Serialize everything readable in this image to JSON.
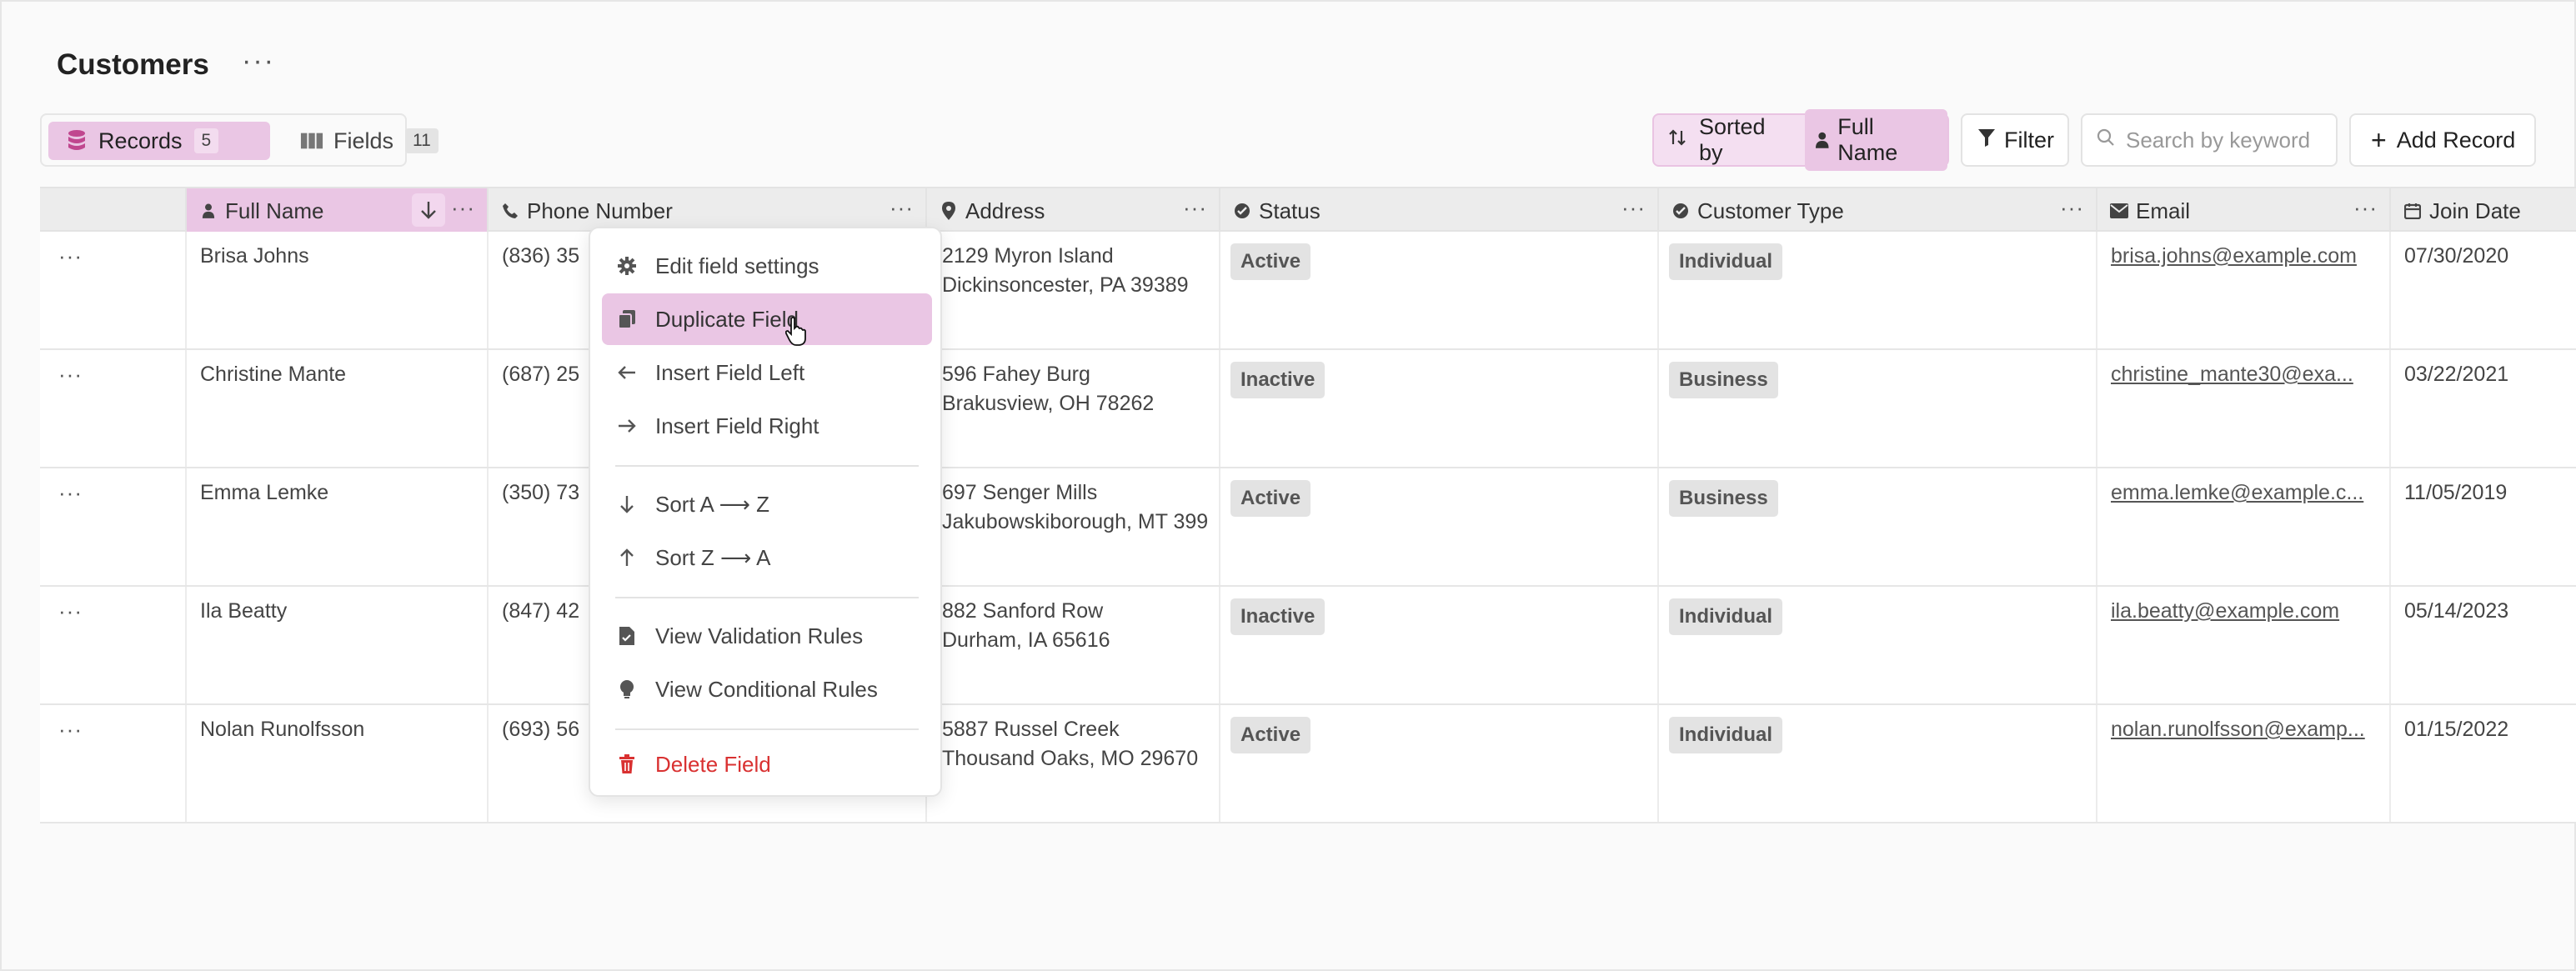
{
  "page": {
    "title": "Customers",
    "title_more": "···"
  },
  "toolbar": {
    "records_label": "Records",
    "records_count": "5",
    "fields_label": "Fields",
    "fields_count": "11",
    "sorted_label": "Sorted by",
    "sorted_field": "Full Name",
    "filter_label": "Filter",
    "search_placeholder": "Search by keyword",
    "add_label": "Add Record"
  },
  "columns": [
    {
      "label": "Full Name",
      "icon": "person-icon"
    },
    {
      "label": "Phone Number",
      "icon": "phone-icon"
    },
    {
      "label": "Address",
      "icon": "pin-icon"
    },
    {
      "label": "Status",
      "icon": "check-circle-icon"
    },
    {
      "label": "Customer Type",
      "icon": "check-circle-icon"
    },
    {
      "label": "Email",
      "icon": "mail-icon"
    },
    {
      "label": "Join Date",
      "icon": "calendar-icon"
    }
  ],
  "row_menu": "···",
  "header_more": "···",
  "rows": [
    {
      "name": "Brisa Johns",
      "phone": "(836) 35",
      "addr1": "2129 Myron Island",
      "addr2": "Dickinsoncester, PA 39389",
      "status": "Active",
      "type": "Individual",
      "email": "brisa.johns@example.com",
      "date": "07/30/2020"
    },
    {
      "name": "Christine Mante",
      "phone": "(687) 25",
      "addr1": "596 Fahey Burg",
      "addr2": "Brakusview, OH 78262",
      "status": "Inactive",
      "type": "Business",
      "email": "christine_mante30@exa...",
      "date": "03/22/2021"
    },
    {
      "name": "Emma Lemke",
      "phone": "(350) 73",
      "addr1": "697 Senger Mills",
      "addr2": "Jakubowskiborough, MT 399",
      "status": "Active",
      "type": "Business",
      "email": "emma.lemke@example.c...",
      "date": "11/05/2019"
    },
    {
      "name": "Ila Beatty",
      "phone": "(847) 42",
      "addr1": "882 Sanford Row",
      "addr2": "Durham, IA 65616",
      "status": "Inactive",
      "type": "Individual",
      "email": "ila.beatty@example.com",
      "date": "05/14/2023"
    },
    {
      "name": "Nolan Runolfsson",
      "phone": "(693) 56",
      "addr1": "5887 Russel Creek",
      "addr2": "Thousand Oaks, MO 29670",
      "status": "Active",
      "type": "Individual",
      "email": "nolan.runolfsson@examp...",
      "date": "01/15/2022"
    }
  ],
  "menu": {
    "edit": "Edit field settings",
    "duplicate": "Duplicate Field",
    "insert_left": "Insert Field Left",
    "insert_right": "Insert Field Right",
    "sort_az": "Sort A ⟶ Z",
    "sort_za": "Sort Z ⟶ A",
    "validation": "View Validation Rules",
    "conditional": "View Conditional Rules",
    "delete": "Delete Field"
  },
  "colors": {
    "accent": "#eac6e4",
    "accent_light": "#f4dff1",
    "danger": "#d93131"
  }
}
